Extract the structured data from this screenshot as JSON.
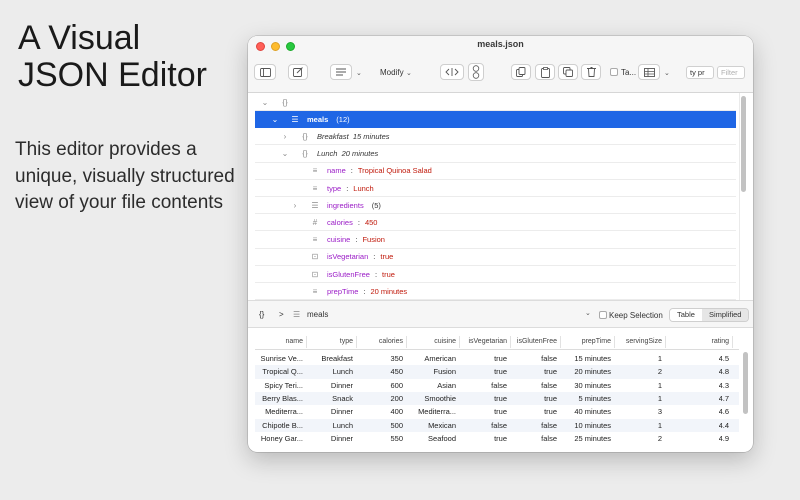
{
  "marketing": {
    "title_lines": [
      "A Visual",
      "JSON Editor"
    ],
    "description": "This editor provides a unique, visually structured view of your file contents"
  },
  "window": {
    "title": "meals.json",
    "toolbar": {
      "modify_label": "Modify",
      "table_check_label": "Ta...",
      "search_value": "ty pr",
      "filter_placeholder": "Filter"
    }
  },
  "tree": {
    "rows": [
      {
        "caret": "⌄",
        "icon": "{}",
        "key": "",
        "value": "",
        "detail": "",
        "count": ""
      },
      {
        "caret": "⌄",
        "icon": "☰",
        "key": "meals",
        "value": "",
        "detail": "",
        "count": "(12)"
      },
      {
        "caret": "›",
        "icon": "{}",
        "key": "",
        "value": "",
        "detail": "Breakfast  15 minutes",
        "count": ""
      },
      {
        "caret": "⌄",
        "icon": "{}",
        "key": "",
        "value": "",
        "detail": "Lunch  20 minutes",
        "count": ""
      },
      {
        "caret": "",
        "icon": "≡",
        "key": "name",
        "value": "Tropical Quinoa Salad",
        "detail": "",
        "count": ""
      },
      {
        "caret": "",
        "icon": "≡",
        "key": "type",
        "value": "Lunch",
        "detail": "",
        "count": ""
      },
      {
        "caret": "›",
        "icon": "☰",
        "key": "ingredients",
        "value": "",
        "detail": "",
        "count": "(5)"
      },
      {
        "caret": "",
        "icon": "#",
        "key": "calories",
        "value": "450",
        "detail": "",
        "count": ""
      },
      {
        "caret": "",
        "icon": "≡",
        "key": "cuisine",
        "value": "Fusion",
        "detail": "",
        "count": ""
      },
      {
        "caret": "",
        "icon": "⊡",
        "key": "isVegetarian",
        "value": "true",
        "detail": "",
        "count": ""
      },
      {
        "caret": "",
        "icon": "⊡",
        "key": "isGlutenFree",
        "value": "true",
        "detail": "",
        "count": ""
      },
      {
        "caret": "",
        "icon": "≡",
        "key": "prepTime",
        "value": "20 minutes",
        "detail": "",
        "count": ""
      }
    ],
    "separator": ":"
  },
  "pathbar": {
    "root_icon": "{}",
    "arrow": ">",
    "list_icon": "☰",
    "current": "meals",
    "keep_selection_label": "Keep Selection",
    "view_table": "Table",
    "view_simplified": "Simplified"
  },
  "table": {
    "columns": [
      "name",
      "type",
      "calories",
      "cuisine",
      "isVegetarian",
      "isGlutenFree",
      "prepTime",
      "servingSize",
      "rating"
    ],
    "rows": [
      [
        "Sunrise Ve...",
        "Breakfast",
        "350",
        "American",
        "true",
        "false",
        "15 minutes",
        "1",
        "4.5"
      ],
      [
        "Tropical Q...",
        "Lunch",
        "450",
        "Fusion",
        "true",
        "true",
        "20 minutes",
        "2",
        "4.8"
      ],
      [
        "Spicy Teri...",
        "Dinner",
        "600",
        "Asian",
        "false",
        "false",
        "30 minutes",
        "1",
        "4.3"
      ],
      [
        "Berry Blas...",
        "Snack",
        "200",
        "Smoothie",
        "true",
        "true",
        "5 minutes",
        "1",
        "4.7"
      ],
      [
        "Mediterra...",
        "Dinner",
        "400",
        "Mediterra...",
        "true",
        "true",
        "40 minutes",
        "3",
        "4.6"
      ],
      [
        "Chipotle B...",
        "Lunch",
        "500",
        "Mexican",
        "false",
        "false",
        "10 minutes",
        "1",
        "4.4"
      ],
      [
        "Honey Gar...",
        "Dinner",
        "550",
        "Seafood",
        "true",
        "false",
        "25 minutes",
        "2",
        "4.9"
      ]
    ]
  }
}
